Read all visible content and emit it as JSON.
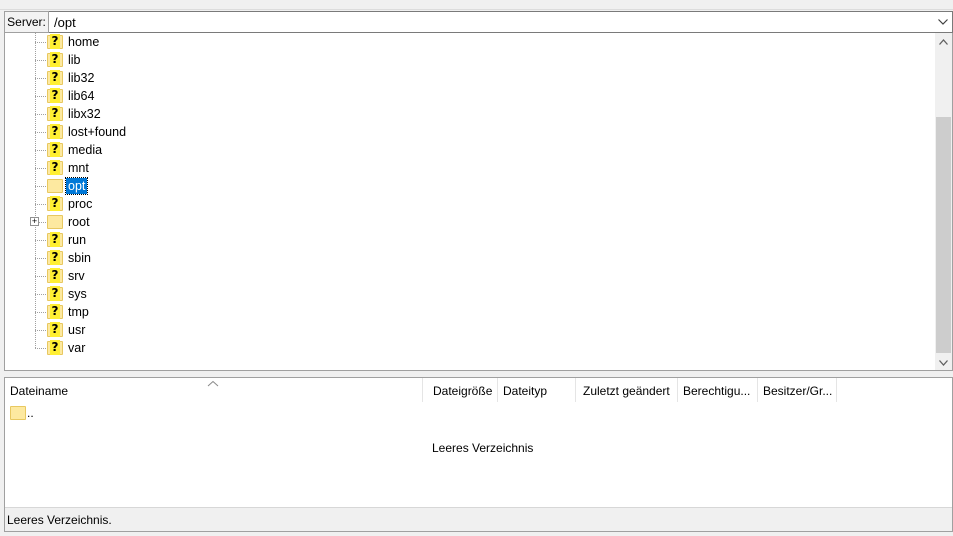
{
  "server_bar": {
    "label": "Server:",
    "path": "/opt"
  },
  "tree": {
    "items": [
      {
        "name": "home",
        "icon": "folder-unknown-icon"
      },
      {
        "name": "lib",
        "icon": "folder-unknown-icon"
      },
      {
        "name": "lib32",
        "icon": "folder-unknown-icon"
      },
      {
        "name": "lib64",
        "icon": "folder-unknown-icon"
      },
      {
        "name": "libx32",
        "icon": "folder-unknown-icon"
      },
      {
        "name": "lost+found",
        "icon": "folder-unknown-icon"
      },
      {
        "name": "media",
        "icon": "folder-unknown-icon"
      },
      {
        "name": "mnt",
        "icon": "folder-unknown-icon"
      },
      {
        "name": "opt",
        "icon": "folder-icon",
        "selected": true
      },
      {
        "name": "proc",
        "icon": "folder-unknown-icon"
      },
      {
        "name": "root",
        "icon": "folder-icon",
        "expander": "+"
      },
      {
        "name": "run",
        "icon": "folder-unknown-icon"
      },
      {
        "name": "sbin",
        "icon": "folder-unknown-icon"
      },
      {
        "name": "srv",
        "icon": "folder-unknown-icon"
      },
      {
        "name": "sys",
        "icon": "folder-unknown-icon"
      },
      {
        "name": "tmp",
        "icon": "folder-unknown-icon"
      },
      {
        "name": "usr",
        "icon": "folder-unknown-icon"
      },
      {
        "name": "var",
        "icon": "folder-unknown-icon"
      }
    ]
  },
  "file_list": {
    "columns": [
      {
        "key": "name",
        "label": "Dateiname"
      },
      {
        "key": "size",
        "label": "Dateigröße"
      },
      {
        "key": "type",
        "label": "Dateityp"
      },
      {
        "key": "modified",
        "label": "Zuletzt geändert"
      },
      {
        "key": "permissions",
        "label": "Berechtigu..."
      },
      {
        "key": "owner",
        "label": "Besitzer/Gr..."
      }
    ],
    "rows": [
      {
        "name": "..",
        "icon": "folder-icon"
      }
    ],
    "empty_message": "Leeres Verzeichnis"
  },
  "status_bar": {
    "text": "Leeres Verzeichnis."
  },
  "colors": {
    "selection": "#0078d7",
    "folder": "#fde9a0",
    "unknown_marker": "#ffef33"
  }
}
